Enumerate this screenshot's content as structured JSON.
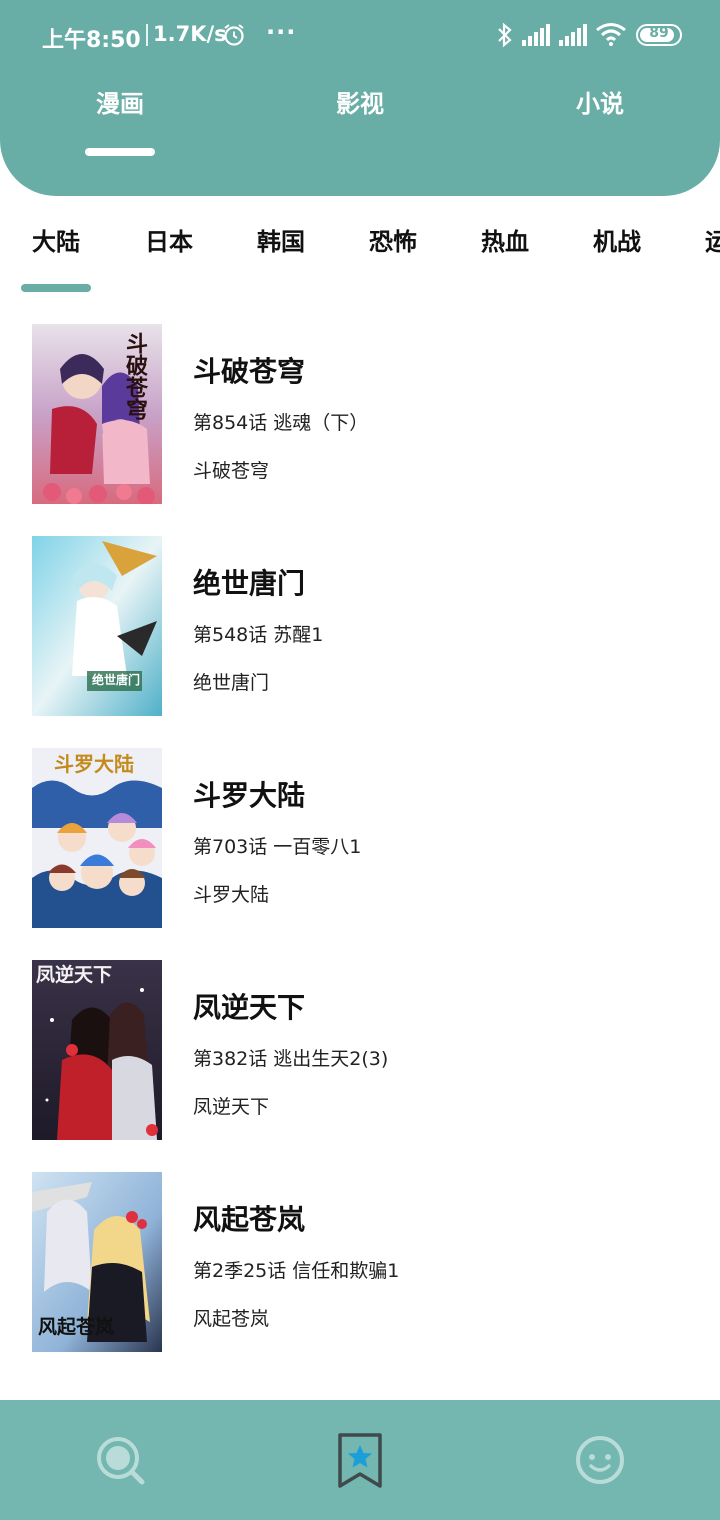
{
  "status_bar": {
    "time": "上午8:50",
    "net_speed": "1.7K/s",
    "more": "···",
    "battery": "89",
    "battery_level": 0.89,
    "icons": [
      "alarm-icon",
      "bluetooth-icon",
      "signal-icon",
      "signal-icon",
      "wifi-icon",
      "battery-icon"
    ]
  },
  "top_tabs": [
    {
      "label": "漫画",
      "active": true
    },
    {
      "label": "影视",
      "active": false
    },
    {
      "label": "小说",
      "active": false
    }
  ],
  "category_tabs": [
    {
      "label": "大陆",
      "active": true
    },
    {
      "label": "日本",
      "active": false
    },
    {
      "label": "韩国",
      "active": false
    },
    {
      "label": "恐怖",
      "active": false
    },
    {
      "label": "热血",
      "active": false
    },
    {
      "label": "机战",
      "active": false
    },
    {
      "label": "运",
      "active": false
    }
  ],
  "comics": [
    {
      "title": "斗破苍穹",
      "chapter": "第854话 逃魂（下）",
      "subtitle": "斗破苍穹",
      "cover_text": "斗破苍穹"
    },
    {
      "title": "绝世唐门",
      "chapter": "第548话 苏醒1",
      "subtitle": "绝世唐门",
      "cover_text": "绝世唐门"
    },
    {
      "title": "斗罗大陆",
      "chapter": "第703话 一百零八1",
      "subtitle": "斗罗大陆",
      "cover_text": "斗罗大陆"
    },
    {
      "title": "凤逆天下",
      "chapter": "第382话 逃出生天2(3)",
      "subtitle": "凤逆天下",
      "cover_text": "凤逆天下"
    },
    {
      "title": "风起苍岚",
      "chapter": "第2季25话 信任和欺骗1",
      "subtitle": "风起苍岚",
      "cover_text": "风起苍岚"
    }
  ],
  "bottom_nav": [
    {
      "icon": "search-icon",
      "active": false
    },
    {
      "icon": "bookmark-star-icon",
      "active": true
    },
    {
      "icon": "smiley-icon",
      "active": false
    }
  ],
  "colors": {
    "primary": "#69ada7",
    "bottom_nav": "#74b6b0",
    "active_icon": "#1a9fd8"
  }
}
